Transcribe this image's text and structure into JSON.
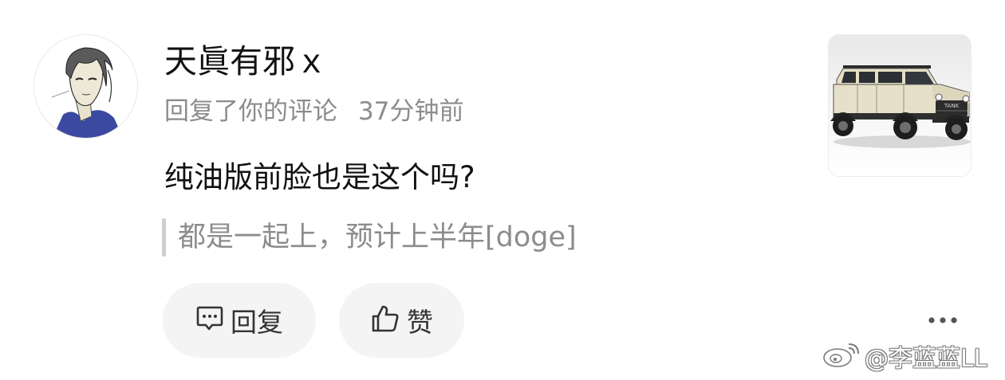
{
  "comment": {
    "username": "天眞有邪ｘ",
    "action": "回复了你的评论",
    "time": "37分钟前",
    "text": "纯油版前脸也是这个吗?",
    "quoted_reply": "都是一起上，预计上半年[doge]"
  },
  "actions": {
    "reply_label": "回复",
    "like_label": "赞"
  },
  "icons": {
    "reply": "comment-bubble-icon",
    "like": "thumbs-up-icon",
    "more": "more-dots-icon",
    "watermark_logo": "weibo-logo-icon"
  },
  "thumbnail": {
    "grille_text": "TANK"
  },
  "watermark": {
    "text": "@李蓝蓝LL"
  },
  "colors": {
    "primary_text": "#111111",
    "secondary_text": "#8c8c8c",
    "button_bg": "#f4f4f4",
    "quote_bar": "#cfcfcf"
  }
}
